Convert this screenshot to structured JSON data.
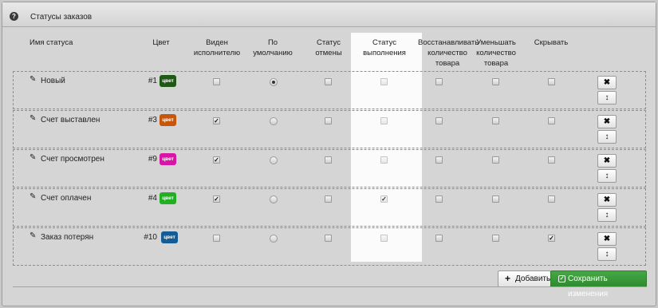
{
  "panel": {
    "title": "Статусы заказов"
  },
  "headers": {
    "name": "Имя статуса",
    "color": "Цвет",
    "visible": "Виден\nисполнителю",
    "default": "По\nумолчанию",
    "cancel": "Статус\nотмены",
    "complete": "Статус\nвыполнения",
    "restore": "Восстанавливать\nколичество\nтовара",
    "reduce": "Уменьшать\nколичество\nтовара",
    "hide": "Скрывать"
  },
  "rows": [
    {
      "name": "Новый",
      "num": "#1",
      "badge": "цвет",
      "color": "#1e5a14",
      "visible": false,
      "default": true,
      "cancel": false,
      "complete": false,
      "restore": false,
      "reduce": false,
      "hide": false
    },
    {
      "name": "Счет выставлен",
      "num": "#3",
      "badge": "цвет",
      "color": "#c8560a",
      "visible": true,
      "default": false,
      "cancel": false,
      "complete": false,
      "restore": false,
      "reduce": false,
      "hide": false
    },
    {
      "name": "Счет просмотрен",
      "num": "#9",
      "badge": "цвет",
      "color": "#d915a6",
      "visible": true,
      "default": false,
      "cancel": false,
      "complete": false,
      "restore": false,
      "reduce": false,
      "hide": false
    },
    {
      "name": "Счет оплачен",
      "num": "#4",
      "badge": "цвет",
      "color": "#22b022",
      "visible": true,
      "default": false,
      "cancel": false,
      "complete": true,
      "restore": false,
      "reduce": false,
      "hide": false
    },
    {
      "name": "Заказ потерян",
      "num": "#10",
      "badge": "цвет",
      "color": "#155c96",
      "visible": false,
      "default": false,
      "cancel": false,
      "complete": false,
      "restore": false,
      "reduce": false,
      "hide": true
    }
  ],
  "row_actions": {
    "delete_glyph": "✖",
    "move_glyph": "↕"
  },
  "footer": {
    "add_label": "Добавить",
    "save_label": "Сохранить изменения"
  },
  "icons": {
    "help": "help-icon",
    "edit": "pencil-icon",
    "add": "plus-icon",
    "save": "check-square-icon"
  },
  "colors": {
    "save_button": "#3a9a3a",
    "highlight_column": "#fbfbfb"
  }
}
